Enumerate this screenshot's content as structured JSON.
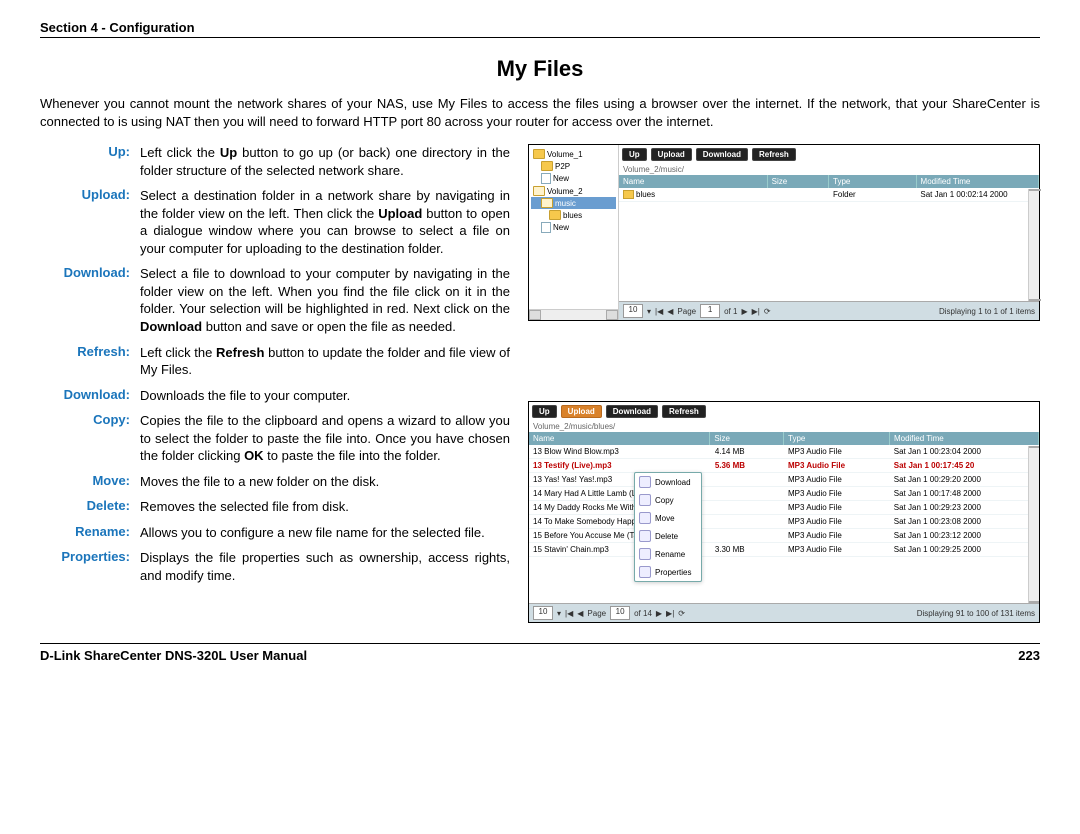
{
  "header": "Section 4 - Configuration",
  "title": "My Files",
  "intro": "Whenever you cannot mount the network shares of your NAS, use My Files to access the files using a browser over the internet. If the network, that your ShareCenter is connected to is using NAT then you will need to forward HTTP port 80 across your router for access over the internet.",
  "defs": [
    {
      "term": "Up:",
      "desc": "Left click the <b>Up</b> button to go up (or back) one directory in the folder structure of the selected network share."
    },
    {
      "term": "Upload:",
      "desc": "Select a destination folder in a network share by navigating in the folder view on the left. Then click the <b>Upload</b> button to open a dialogue window where you can browse to select a file on your computer for uploading to the destination folder."
    },
    {
      "term": "Download:",
      "desc": "Select a file to download to your computer by navigating in the folder view on the left. When you find the file click on it in the folder. Your selection will be highlighted in red. Next click on the <b>Download</b> button and save or open the file as needed."
    },
    {
      "term": "Refresh:",
      "desc": "Left click the <b>Refresh</b> button to update the folder and file view of My Files."
    },
    {
      "term": "Download:",
      "desc": "Downloads the file to your computer."
    },
    {
      "term": "Copy:",
      "desc": "Copies the file to the clipboard and opens a wizard to allow you to select the folder to paste the file into. Once you have chosen the folder clicking <b>OK</b> to paste the file into the folder."
    },
    {
      "term": "Move:",
      "desc": "Moves the file to a new folder on the disk."
    },
    {
      "term": "Delete:",
      "desc": "Removes the selected file from disk."
    },
    {
      "term": "Rename:",
      "desc": "Allows you to configure a new file name for the selected file."
    },
    {
      "term": "Properties:",
      "desc": "Displays the file properties such as ownership, access rights, and modify time."
    }
  ],
  "toolbar": {
    "up": "Up",
    "upload": "Upload",
    "download": "Download",
    "refresh": "Refresh"
  },
  "shot1": {
    "breadcrumb": "Volume_2/music/",
    "tree": {
      "vol1": "Volume_1",
      "p2p": "P2P",
      "new": "New",
      "vol2": "Volume_2",
      "music": "music",
      "blues": "blues",
      "new2": "New"
    },
    "cols": {
      "name": "Name",
      "size": "Size",
      "type": "Type",
      "mod": "Modified Time"
    },
    "row": {
      "name": "blues",
      "type": "Folder",
      "mod": "Sat Jan 1 00:02:14 2000"
    },
    "pager": {
      "per": "10",
      "page_lbl": "Page",
      "page": "1",
      "of": "of 1",
      "disp": "Displaying 1 to 1 of 1 items"
    }
  },
  "shot2": {
    "breadcrumb": "Volume_2/music/blues/",
    "cols": {
      "name": "Name",
      "size": "Size",
      "type": "Type",
      "mod": "Modified Time"
    },
    "rows": [
      {
        "name": "13 Blow Wind Blow.mp3",
        "size": "4.14 MB",
        "type": "MP3 Audio File",
        "mod": "Sat Jan 1 00:23:04 2000"
      },
      {
        "name": "13 Testify (Live).mp3",
        "size": "5.36 MB",
        "type": "MP3 Audio File",
        "mod": "Sat Jan 1 00:17:45 20",
        "sel": true
      },
      {
        "name": "13 Yas! Yas! Yas!.mp3",
        "size": "",
        "type": "MP3 Audio File",
        "mod": "Sat Jan 1 00:29:20 2000"
      },
      {
        "name": "14 Mary Had A Little Lamb (Live).m",
        "size": "",
        "type": "MP3 Audio File",
        "mod": "Sat Jan 1 00:17:48 2000"
      },
      {
        "name": "14 My Daddy Rocks Me With One",
        "size": "",
        "type": "MP3 Audio File",
        "mod": "Sat Jan 1 00:29:23 2000"
      },
      {
        "name": "14 To Make Somebody Happy.mp",
        "size": "",
        "type": "MP3 Audio File",
        "mod": "Sat Jan 1 00:23:08 2000"
      },
      {
        "name": "15 Before You Accuse Me (Take A Look).mp3",
        "size": "",
        "type": "MP3 Audio File",
        "mod": "Sat Jan 1 00:23:12 2000"
      },
      {
        "name": "15 Stavin' Chain.mp3",
        "size": "3.30 MB",
        "type": "MP3 Audio File",
        "mod": "Sat Jan 1 00:29:25 2000"
      }
    ],
    "ctx": {
      "download": "Download",
      "copy": "Copy",
      "move": "Move",
      "delete": "Delete",
      "rename": "Rename",
      "properties": "Properties"
    },
    "pager": {
      "per": "10",
      "page_lbl": "Page",
      "page": "10",
      "of": "of 14",
      "disp": "Displaying 91 to 100 of 131 items"
    }
  },
  "footer": {
    "left": "D-Link ShareCenter DNS-320L User Manual",
    "right": "223"
  }
}
